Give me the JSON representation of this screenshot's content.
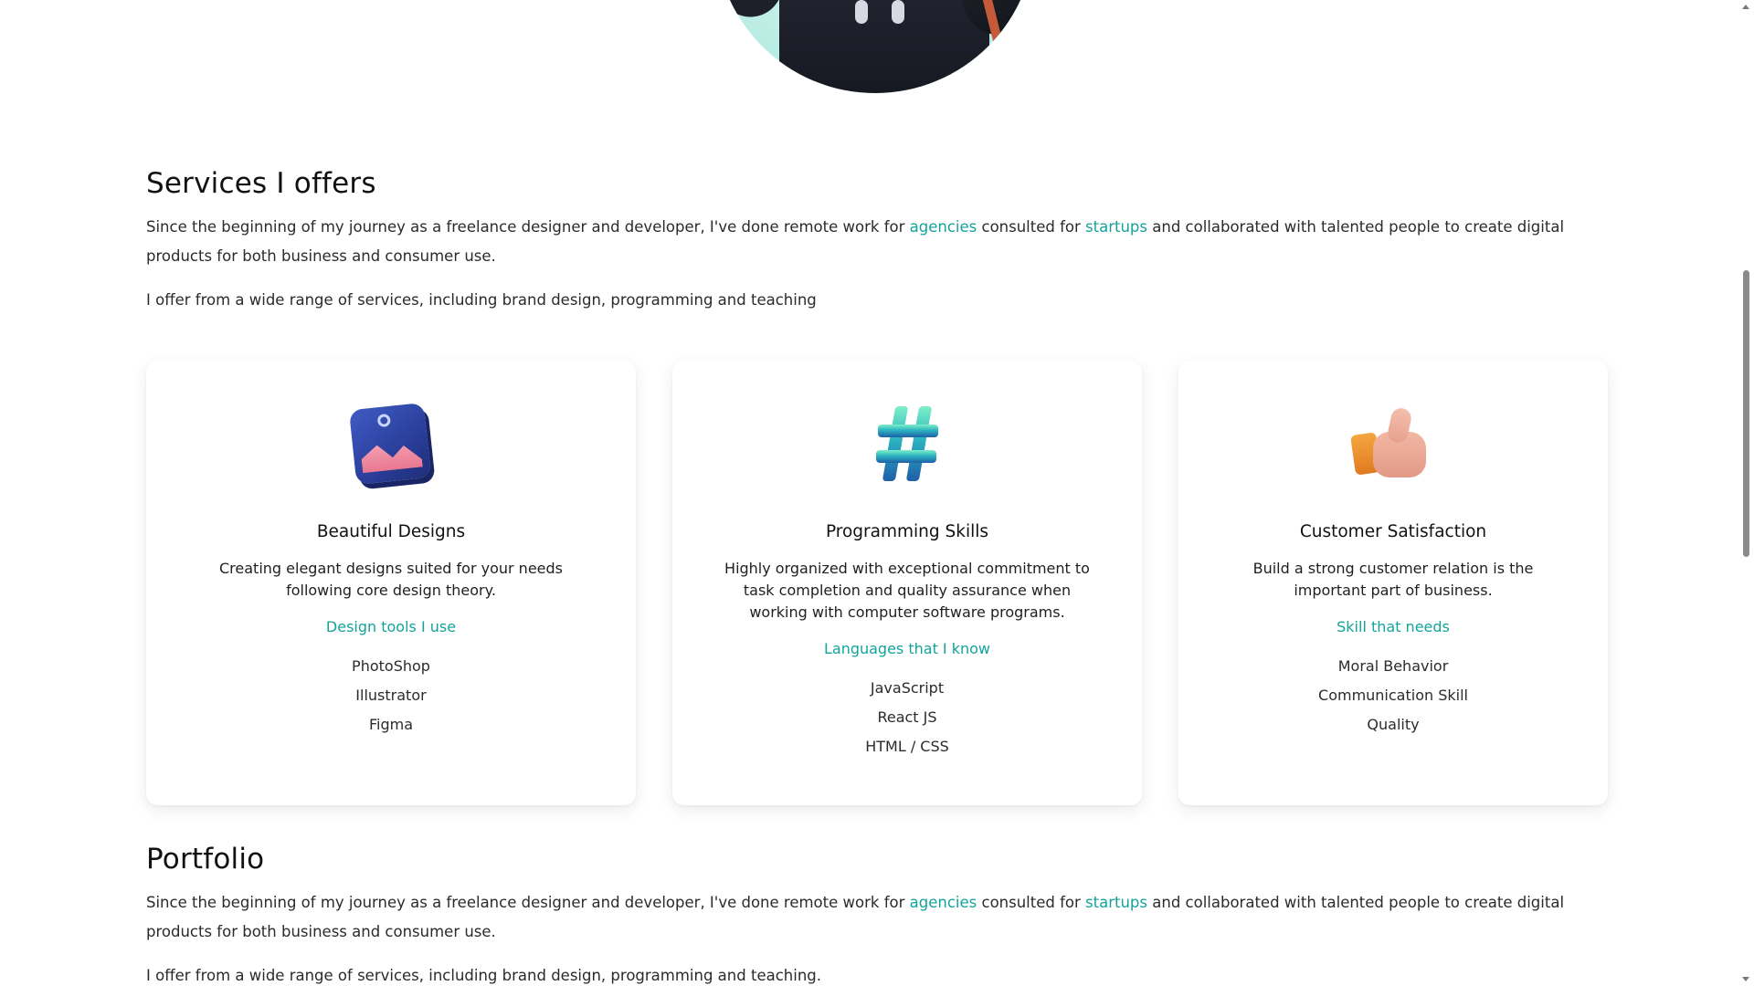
{
  "services": {
    "title": "Services I offers",
    "intro_part1": "Since the beginning of my journey as a freelance designer and developer, I've done remote work for ",
    "intro_link1": "agencies",
    "intro_part2": " consulted for ",
    "intro_link2": "startups",
    "intro_part3": " and collaborated with talented people to create digital products for both business and consumer use.",
    "intro2": "I offer from a wide range of services, including brand design, programming and teaching"
  },
  "cards": [
    {
      "icon": "picture-frame-icon",
      "title": "Beautiful Designs",
      "desc": "Creating elegant designs suited for your needs following core design theory.",
      "sub": "Design tools I use",
      "items": [
        "PhotoShop",
        "Illustrator",
        "Figma"
      ]
    },
    {
      "icon": "hashtag-icon",
      "title": "Programming Skills",
      "desc": "Highly organized with exceptional commitment to task completion and quality assurance when working with computer software programs.",
      "sub": "Languages that I know",
      "items": [
        "JavaScript",
        "React JS",
        "HTML / CSS"
      ]
    },
    {
      "icon": "thumbs-up-icon",
      "title": "Customer Satisfaction",
      "desc": "Build a strong customer relation is the important part of business.",
      "sub": "Skill that needs",
      "items": [
        "Moral Behavior",
        "Communication Skill",
        "Quality"
      ]
    }
  ],
  "portfolio": {
    "title": "Portfolio",
    "intro_part1": "Since the beginning of my journey as a freelance designer and developer, I've done remote work for ",
    "intro_link1": "agencies",
    "intro_part2": " consulted for ",
    "intro_link2": "startups",
    "intro_part3": " and collaborated with talented people to create digital products for both business and consumer use.",
    "intro2": "I offer from a wide range of services, including brand design, programming and teaching."
  },
  "colors": {
    "accent": "#14a39a",
    "text": "#2b2b2b",
    "background": "#ffffff"
  }
}
